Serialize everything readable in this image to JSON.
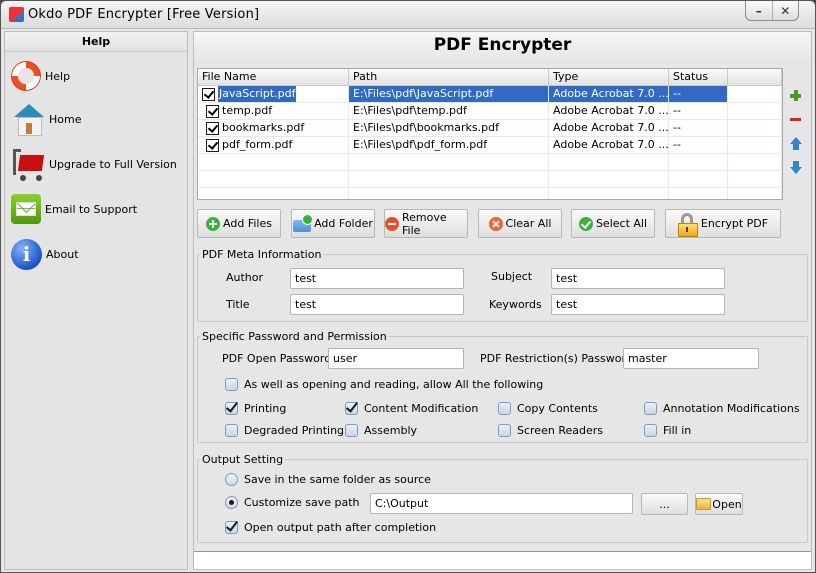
{
  "window": {
    "title": "Okdo PDF Encrypter [Free Version]",
    "minimize_label": "–",
    "close_label": "✕"
  },
  "sidebar": {
    "header": "Help",
    "items": [
      {
        "label": "Help",
        "icon": "lifebuoy-icon"
      },
      {
        "label": "Home",
        "icon": "home-icon"
      },
      {
        "label": "Upgrade to Full Version",
        "icon": "cart-icon"
      },
      {
        "label": "Email to Support",
        "icon": "mail-icon"
      },
      {
        "label": "About",
        "icon": "info-icon"
      }
    ]
  },
  "main": {
    "title": "PDF Encrypter"
  },
  "file_table": {
    "columns": [
      "File Name",
      "Path",
      "Type",
      "Status",
      ""
    ],
    "rows": [
      {
        "checked": true,
        "selected": true,
        "name": "JavaScript.pdf",
        "path": "E:\\Files\\pdf\\JavaScript.pdf",
        "type": "Adobe Acrobat 7.0 ...",
        "status": "--"
      },
      {
        "checked": true,
        "selected": false,
        "name": "temp.pdf",
        "path": "E:\\Files\\pdf\\temp.pdf",
        "type": "Adobe Acrobat 7.0 ...",
        "status": "--"
      },
      {
        "checked": true,
        "selected": false,
        "name": "bookmarks.pdf",
        "path": "E:\\Files\\pdf\\bookmarks.pdf",
        "type": "Adobe Acrobat 7.0 ...",
        "status": "--"
      },
      {
        "checked": true,
        "selected": false,
        "name": "pdf_form.pdf",
        "path": "E:\\Files\\pdf\\pdf_form.pdf",
        "type": "Adobe Acrobat 7.0 ...",
        "status": "--"
      }
    ],
    "side_tools": [
      "add-icon",
      "remove-icon",
      "move-up-icon",
      "move-down-icon"
    ]
  },
  "buttons": {
    "add_files": "Add Files",
    "add_folder": "Add Folder",
    "remove_file": "Remove File",
    "clear_all": "Clear All",
    "select_all": "Select All",
    "encrypt_pdf": "Encrypt PDF"
  },
  "meta": {
    "legend": "PDF Meta Information",
    "author_label": "Author",
    "author_value": "test",
    "title_label": "Title",
    "title_value": "test",
    "subject_label": "Subject",
    "subject_value": "test",
    "keywords_label": "Keywords",
    "keywords_value": "test"
  },
  "password": {
    "legend": "Specific Password and Permission",
    "open_label": "PDF Open Password",
    "open_value": "user",
    "restrict_label": "PDF Restriction(s) Password",
    "restrict_value": "master",
    "allow_all_label": "As well as opening and reading, allow All the following",
    "allow_all_checked": false,
    "permissions": [
      {
        "label": "Printing",
        "checked": true
      },
      {
        "label": "Content Modification",
        "checked": true
      },
      {
        "label": "Copy Contents",
        "checked": false
      },
      {
        "label": "Annotation Modifications",
        "checked": false
      },
      {
        "label": "Degraded Printing",
        "checked": false
      },
      {
        "label": "Assembly",
        "checked": false
      },
      {
        "label": "Screen Readers",
        "checked": false
      },
      {
        "label": "Fill in",
        "checked": false
      }
    ]
  },
  "output": {
    "legend": "Output Setting",
    "same_folder_label": "Save in the same folder as source",
    "same_folder_selected": false,
    "custom_label": "Customize save path",
    "custom_selected": true,
    "path_value": "C:\\Output",
    "browse_label": "...",
    "open_label": "Open",
    "open_after_label": "Open output path after completion",
    "open_after_checked": true
  },
  "statusbar": {
    "text": ""
  }
}
